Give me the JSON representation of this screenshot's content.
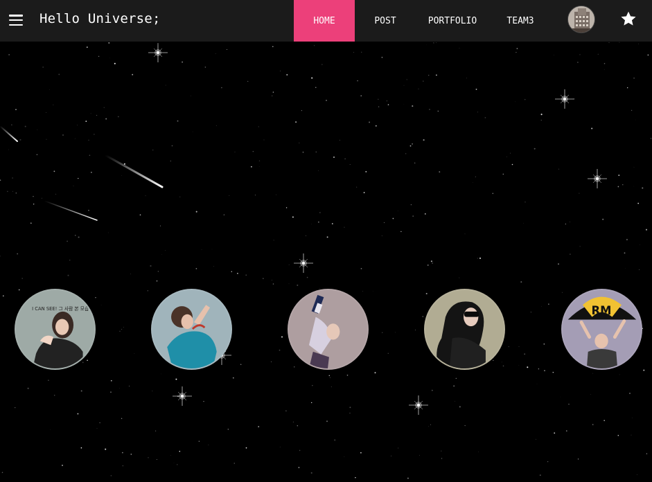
{
  "header": {
    "brand": "Hello Universe;",
    "nav": [
      {
        "label": "HOME",
        "active": true
      },
      {
        "label": "POST",
        "active": false
      },
      {
        "label": "PORTFOLIO",
        "active": false
      },
      {
        "label": "TEAM3",
        "active": false
      }
    ],
    "accent_color": "#ec407a",
    "menu_icon": "menu-icon",
    "star_icon": "star-icon"
  },
  "main": {
    "background": "starfield",
    "profiles": [
      {
        "icon": "profile-illustration-1",
        "label": "I CAN SEE! 그 사람 본 모습이 보여"
      },
      {
        "icon": "profile-illustration-2"
      },
      {
        "icon": "profile-illustration-3"
      },
      {
        "icon": "profile-illustration-4"
      },
      {
        "icon": "profile-illustration-5",
        "label": "RM"
      }
    ]
  }
}
